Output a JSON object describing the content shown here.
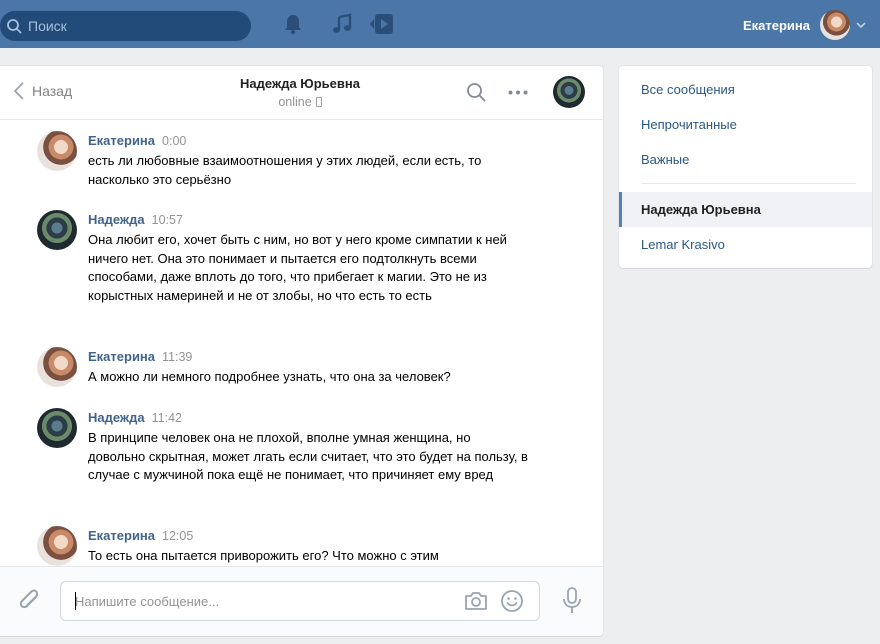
{
  "topbar": {
    "search_placeholder": "Поиск",
    "icons": [
      "search-icon",
      "bell-icon",
      "music-icon",
      "video-play-icon",
      "chevron-down-icon"
    ],
    "user_name": "Екатерина",
    "colors": {
      "bar": "#4a76a8",
      "search_bg": "#224b7a"
    }
  },
  "chat": {
    "back_label": "Назад",
    "title": "Надежда Юрьевна",
    "status": "online",
    "messages": [
      {
        "author": "Екатерина",
        "time": "0:00",
        "text": "есть ли любовные взаимоотношения у этих людей, если есть, то насколько это серьёзно"
      },
      {
        "author": "Надежда",
        "time": "10:57",
        "text": "Она любит его, хочет быть с ним, но вот у него кроме симпатии к ней ничего нет. Она это понимает и пытается его подтолкнуть всеми способами, даже вплоть до того, что прибегает к магии. Это не из корыстных намериней и не от злобы, но что есть то есть"
      },
      {
        "author": "Екатерина",
        "time": "11:39",
        "text": "А можно ли немного подробнее узнать, что она за человек?"
      },
      {
        "author": "Надежда",
        "time": "11:42",
        "text": "В принципе человек она не плохой, вполне умная женщина, но довольно скрытная, может лгать если считает, что это будет на пользу, в случае с мужчиной пока ещё не понимает, что причиняет ему вред"
      },
      {
        "author": "Екатерина",
        "time": "12:05",
        "text": "То есть она пытается приворожить его? Что можно с этим"
      }
    ],
    "composer_placeholder": "Напишите сообщение...",
    "author_color": "#42648b"
  },
  "menu": {
    "items": [
      {
        "label": "Все сообщения"
      },
      {
        "label": "Непрочитанные"
      },
      {
        "label": "Важные"
      },
      {
        "label": "Надежда Юрьевна",
        "active": true
      },
      {
        "label": "Lemar Krasivo"
      }
    ],
    "link_color": "#2a5885"
  }
}
